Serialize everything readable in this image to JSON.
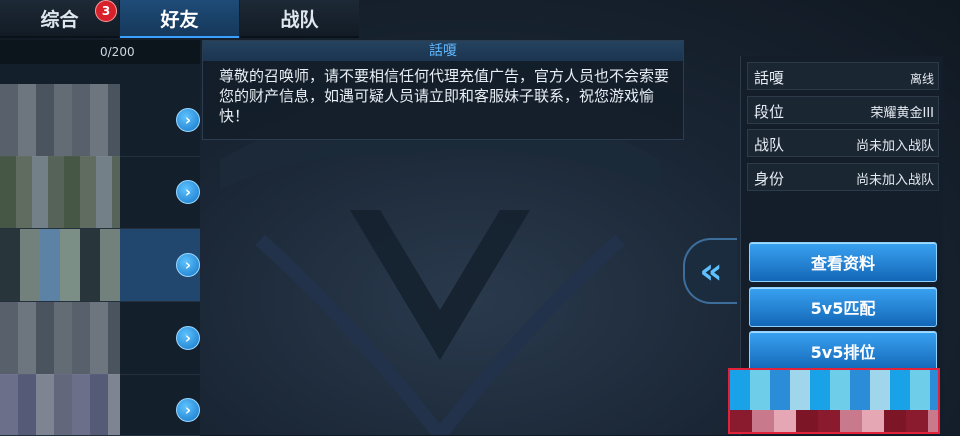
{
  "tabs": [
    {
      "label": "综合",
      "badge": "3"
    },
    {
      "label": "好友"
    },
    {
      "label": "战队"
    }
  ],
  "friend_list": {
    "count_text": "0/200"
  },
  "chat": {
    "title": "話嗄",
    "message": "尊敬的召唤师，请不要相信任何代理充值广告，官方人员也不会索要您的财产信息，如遇可疑人员请立即和客服妹子联系，祝您游戏愉快！"
  },
  "profile": {
    "name": "話嗄",
    "status": "离线",
    "fields": [
      {
        "key": "段位",
        "value": "荣耀黄金III"
      },
      {
        "key": "战队",
        "value": "尚未加入战队"
      },
      {
        "key": "身份",
        "value": "尚未加入战队"
      }
    ]
  },
  "actions": {
    "view_profile": "查看资料",
    "match_5v5": "5v5匹配",
    "ranked_5v5": "5v5排位"
  },
  "icons": {
    "row_arrow": "chevron-right-icon",
    "collapse": "double-chevron-left-icon"
  },
  "colors": {
    "accent": "#3aa2f2",
    "badge": "#d8222b",
    "chat_title": "#5fb8ff"
  }
}
